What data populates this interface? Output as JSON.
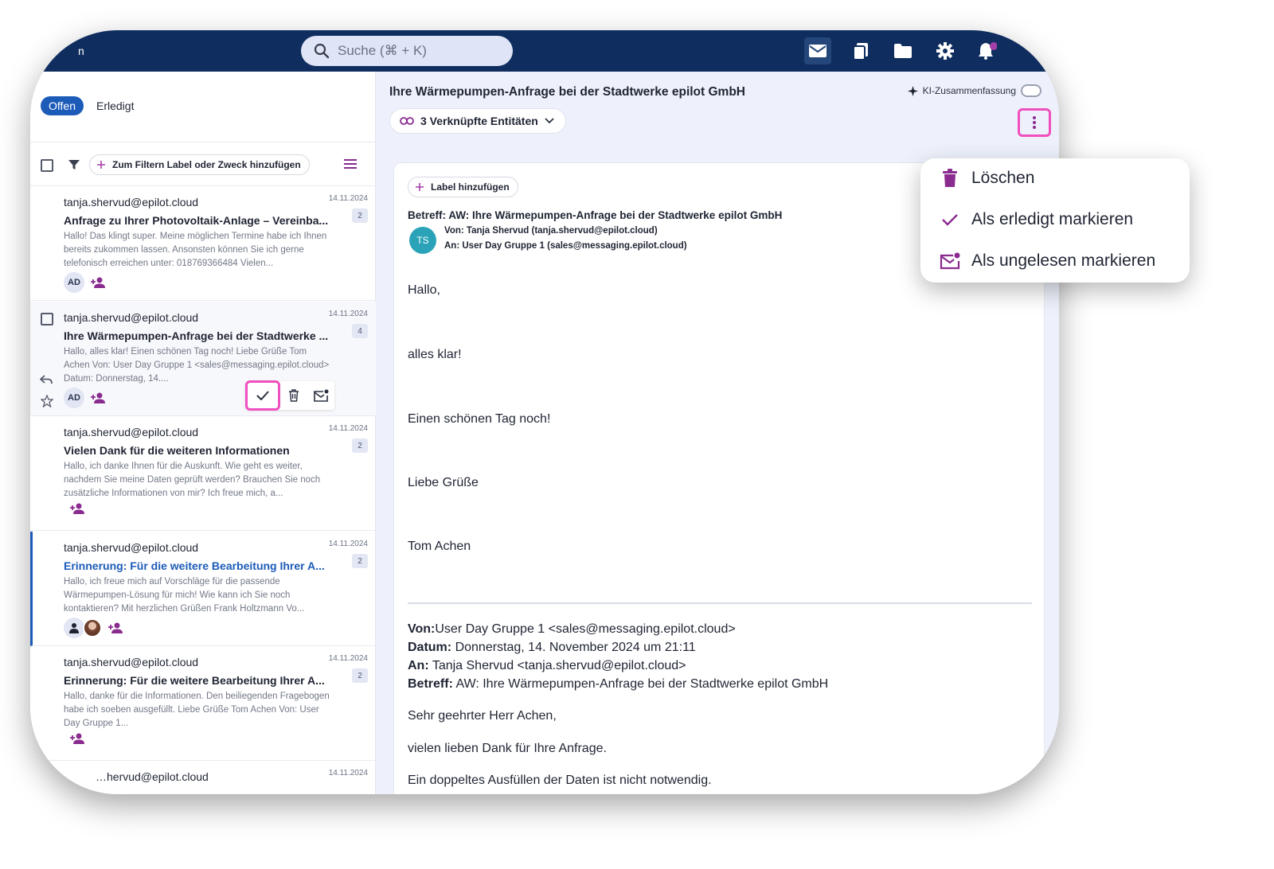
{
  "topbar": {
    "brand": "n",
    "search_placeholder": "Suche (⌘ + K)"
  },
  "status_tabs": {
    "open": "Offen",
    "done": "Erledigt"
  },
  "filter": {
    "chip_label": "Zum Filtern Label oder Zweck hinzufügen"
  },
  "mails": [
    {
      "from": "tanja.shervud@epilot.cloud",
      "date": "14.11.2024",
      "count": "2",
      "subject": "Anfrage zu Ihrer Photovoltaik-Anlage – Vereinba...",
      "preview": "Hallo! Das klingt super. Meine möglichen Termine habe ich Ihnen bereits zukommen lassen. Ansonsten können Sie ich gerne telefonisch erreichen unter: 018769366484 Vielen...",
      "avatar": "AD"
    },
    {
      "from": "tanja.shervud@epilot.cloud",
      "date": "14.11.2024",
      "count": "4",
      "subject": "Ihre Wärmepumpen-Anfrage bei der Stadtwerke ...",
      "preview": "Hallo, alles klar! Einen schönen Tag noch! Liebe Grüße Tom Achen Von: User Day Gruppe 1 <sales@messaging.epilot.cloud> Datum: Donnerstag, 14....",
      "avatar": "AD"
    },
    {
      "from": "tanja.shervud@epilot.cloud",
      "date": "14.11.2024",
      "count": "2",
      "subject": "Vielen Dank für die weiteren Informationen",
      "preview": "Hallo, ich danke Ihnen für die Auskunft. Wie geht es weiter, nachdem Sie meine Daten geprüft werden? Brauchen Sie noch zusätzliche Informationen von mir? Ich freue mich, a..."
    },
    {
      "from": "tanja.shervud@epilot.cloud",
      "date": "14.11.2024",
      "count": "2",
      "subject": "Erinnerung: Für die weitere Bearbeitung Ihrer A...",
      "preview": "Hallo, ich freue mich auf Vorschläge für die passende Wärmepumpen-Lösung für mich! Wie kann ich Sie noch kontaktieren? Mit herzlichen Grüßen Frank Holtzmann Vo..."
    },
    {
      "from": "tanja.shervud@epilot.cloud",
      "date": "14.11.2024",
      "count": "2",
      "subject": "Erinnerung: Für die weitere Bearbeitung Ihrer A...",
      "preview": "Hallo, danke für die Informationen. Den beiliegenden Fragebogen habe ich soeben ausgefüllt. Liebe Grüße Tom Achen Von: User Day Gruppe 1..."
    },
    {
      "from": "…hervud@epilot.cloud",
      "date": "14.11.2024"
    }
  ],
  "mail": {
    "title": "Ihre Wärmepumpen-Anfrage bei der Stadtwerke epilot GmbH",
    "ki_label": "KI-Zusammenfassung",
    "linked_entities": "3 Verknüpfte Entitäten",
    "label_add": "Label hinzufügen",
    "betreff": "Betreff: AW: Ihre Wärmepumpen-Anfrage bei der Stadtwerke epilot GmbH",
    "avatar": "TS",
    "from_label": "Von:",
    "from_value": "Tanja Shervud (tanja.shervud@epilot.cloud)",
    "to_label": "An:",
    "to_value": "User Day Gruppe 1 (sales@messaging.epilot.cloud)",
    "body": [
      "Hallo,",
      "alles klar!",
      "Einen schönen Tag noch!",
      "Liebe Grüße",
      "Tom Achen"
    ],
    "quote": {
      "von_label": "Von:",
      "von_value": "User Day Gruppe 1 <sales@messaging.epilot.cloud>",
      "datum_label": "Datum:",
      "datum_value": "Donnerstag, 14. November 2024 um 21:11",
      "an_label": "An:",
      "an_value": "Tanja Shervud <tanja.shervud@epilot.cloud>",
      "betreff_label": "Betreff:",
      "betreff_value": "AW: Ihre Wärmepumpen-Anfrage bei der Stadtwerke epilot GmbH",
      "lines": [
        "Sehr geehrter Herr Achen,",
        "vielen lieben Dank für Ihre Anfrage.",
        "Ein doppeltes Ausfüllen der Daten ist nicht notwendig."
      ]
    }
  },
  "menu": {
    "delete": "Löschen",
    "mark_done": "Als erledigt markieren",
    "mark_unread": "Als ungelesen markieren"
  },
  "colors": {
    "topbar": "#0f2d5e",
    "accent": "#1c5bb8",
    "highlight": "#f04fbf",
    "icon_purple": "#8a2b8f"
  }
}
